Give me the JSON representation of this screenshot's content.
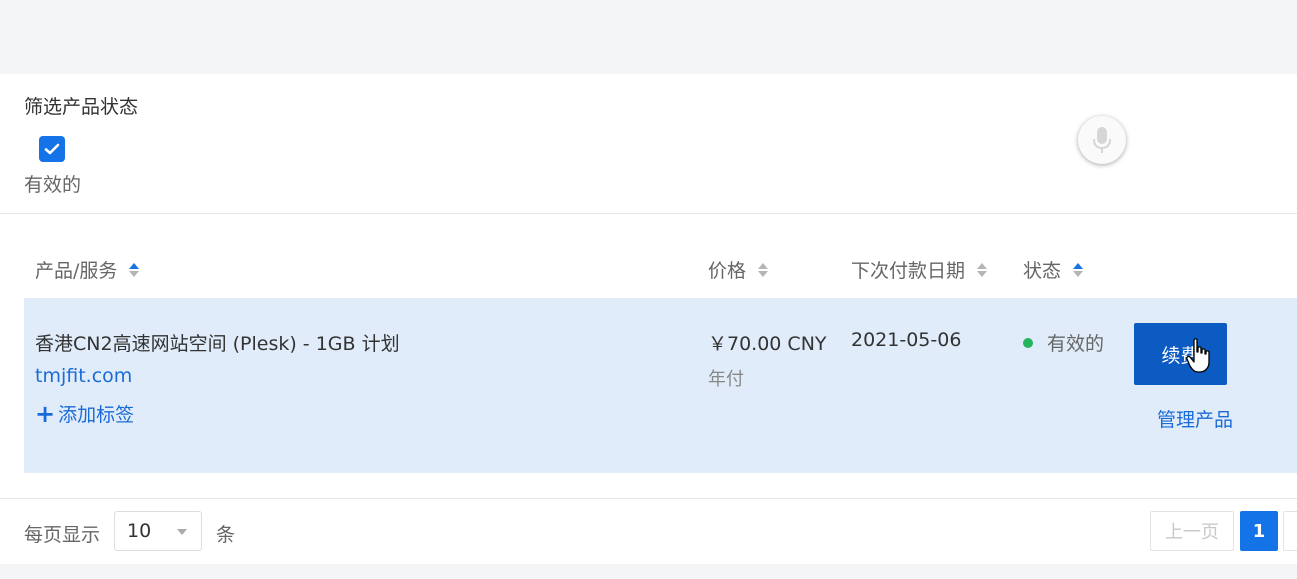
{
  "filter": {
    "title": "筛选产品状态",
    "active_label": "有效的",
    "active_checked": true
  },
  "table": {
    "columns": [
      {
        "label": "产品/服务"
      },
      {
        "label": "价格"
      },
      {
        "label": "下次付款日期"
      },
      {
        "label": "状态"
      }
    ],
    "rows": [
      {
        "product": "香港CN2高速网站空间 (Plesk) - 1GB 计划",
        "domain": "tmjfit.com",
        "add_tag": "添加标签",
        "price": "￥70.00 CNY",
        "billing_cycle": "年付",
        "next_due": "2021-05-06",
        "status": "有效的",
        "renew": "续费",
        "manage": "管理产品"
      }
    ]
  },
  "pagination": {
    "per_page_label": "每页显示",
    "per_page_value": "10",
    "per_page_unit": "条",
    "prev": "上一页",
    "current_page": "1"
  },
  "colors": {
    "accent": "#1473e6",
    "button": "#0b5bc2",
    "row_highlight": "#e1ecfa",
    "status_active": "#22b55b",
    "link": "#1a6bd6"
  }
}
